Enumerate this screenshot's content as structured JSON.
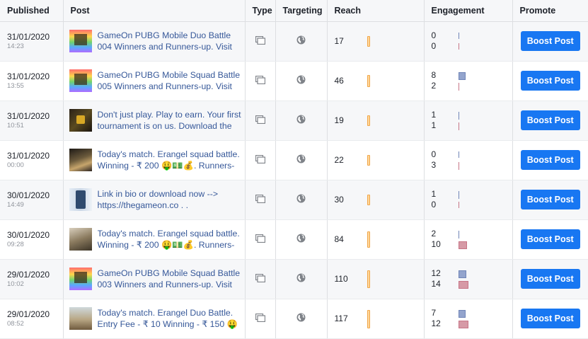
{
  "columns": {
    "published": "Published",
    "post": "Post",
    "type": "Type",
    "targeting": "Targeting",
    "reach": "Reach",
    "engagement": "Engagement",
    "promote": "Promote"
  },
  "type_icon": "album-icon",
  "targeting_icon": "globe-icon",
  "colors": {
    "button": "#1877f2",
    "link": "#365899",
    "reach_bar": "#ffd79a",
    "engagement_primary": "#93a4cd",
    "engagement_secondary": "#d69aa6"
  },
  "rows": [
    {
      "date": "31/01/2020",
      "time": "14:23",
      "thumb": "pubg-rainbow",
      "text": "GameOn PUBG Mobile Duo Battle\n004 Winners and Runners-up. Visit",
      "reach": "17",
      "eng_top": "0",
      "eng_bottom": "0",
      "button": "Boost Post"
    },
    {
      "date": "31/01/2020",
      "time": "13:55",
      "thumb": "pubg-rainbow",
      "text": "GameOn PUBG Mobile Squad Battle\n005 Winners and Runners-up. Visit",
      "reach": "46",
      "eng_top": "8",
      "eng_bottom": "2",
      "button": "Boost Post"
    },
    {
      "date": "31/01/2020",
      "time": "10:51",
      "thumb": "gameon-dark",
      "text": "Don't just play. Play to earn. Your first\ntournament is on us. Download the",
      "reach": "19",
      "eng_top": "1",
      "eng_bottom": "1",
      "button": "Boost Post"
    },
    {
      "date": "31/01/2020",
      "time": "00:00",
      "thumb": "battle-scene",
      "text": "Today's match. Erangel squad battle.\nWinning - ₹ 200 🤑💵💰. Runners-",
      "reach": "22",
      "eng_top": "0",
      "eng_bottom": "3",
      "button": "Boost Post"
    },
    {
      "date": "30/01/2020",
      "time": "14:49",
      "thumb": "phone-screens",
      "text": "Link in bio or download now -->\nhttps://thegameon.co . .",
      "reach": "30",
      "eng_top": "1",
      "eng_bottom": "0",
      "button": "Boost Post"
    },
    {
      "date": "30/01/2020",
      "time": "09:28",
      "thumb": "field-scene",
      "text": "Today's match. Erangel squad battle.\nWinning - ₹ 200 🤑💵💰. Runners-",
      "reach": "84",
      "eng_top": "2",
      "eng_bottom": "10",
      "button": "Boost Post"
    },
    {
      "date": "29/01/2020",
      "time": "10:02",
      "thumb": "pubg-rainbow",
      "text": "GameOn PUBG Mobile Squad Battle\n003 Winners and Runners-up. Visit",
      "reach": "110",
      "eng_top": "12",
      "eng_bottom": "14",
      "button": "Boost Post"
    },
    {
      "date": "29/01/2020",
      "time": "08:52",
      "thumb": "desert-scene",
      "text": "Today's match. Erangel Duo Battle.\nEntry Fee - ₹ 10 Winning - ₹ 150 🤑",
      "reach": "117",
      "eng_top": "7",
      "eng_bottom": "12",
      "button": "Boost Post"
    }
  ]
}
